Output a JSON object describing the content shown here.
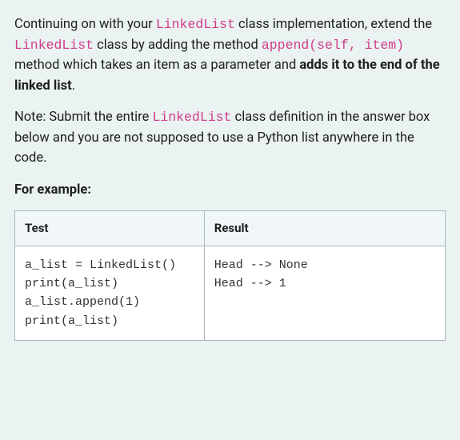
{
  "intro": {
    "t1": "Continuing on with your ",
    "c1": "LinkedList",
    "t2": " class implementation, extend the ",
    "c2": "LinkedList",
    "t3": " class by adding the method ",
    "c3": "append(self, item)",
    "t4": " method which takes an item as a parameter and ",
    "b1": "adds it to the end of the linked list",
    "t5": "."
  },
  "note": {
    "t1": "Note: Submit the entire ",
    "c1": "LinkedList",
    "t2": " class definition in the answer box below and you are not supposed to use a Python list anywhere in the code."
  },
  "example_label": "For example:",
  "table": {
    "header": {
      "test": "Test",
      "result": "Result"
    },
    "rows": [
      {
        "test": "a_list = LinkedList()\nprint(a_list)\na_list.append(1)\nprint(a_list)",
        "result": "Head --> None\nHead --> 1"
      }
    ]
  }
}
